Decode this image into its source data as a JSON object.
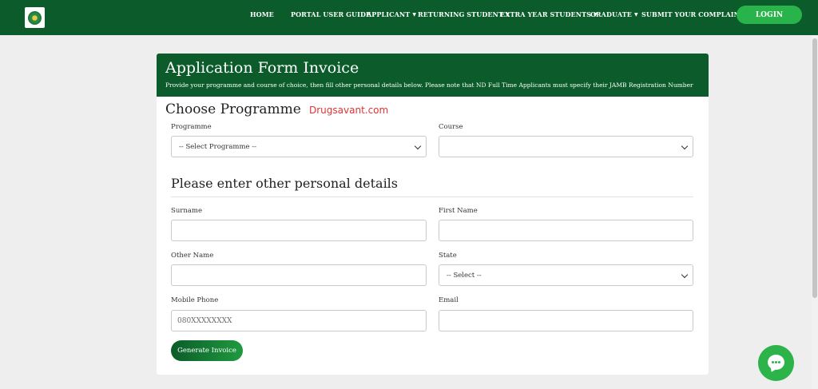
{
  "nav": {
    "home": "HOME",
    "portal_user_guide": "PORTAL USER GUIDE",
    "applicant": "APPLICANT",
    "returning_student": "RETURNING STUDENT",
    "extra_year_students": "EXTRA YEAR STUDENTS",
    "graduate": "GRADUATE",
    "submit_complaint": "SUBMIT YOUR COMPLAINT",
    "login": "LOGIN"
  },
  "card": {
    "title": "Application Form Invoice",
    "subtitle": "Provide your programme and course of choice, then fill other personal details below. Please note that ND Full Time Applicants must specify their JAMB Registration Number"
  },
  "choose_programme": {
    "heading": "Choose Programme",
    "watermark": "Drugsavant.com",
    "programme_label": "Programme",
    "programme_selected": "-- Select Programme --",
    "course_label": "Course",
    "course_selected": ""
  },
  "personal": {
    "heading": "Please enter other personal details",
    "surname_label": "Surname",
    "first_name_label": "First Name",
    "other_name_label": "Other Name",
    "state_label": "State",
    "state_selected": "-- Select --",
    "mobile_label": "Mobile Phone",
    "mobile_placeholder": "080XXXXXXXX",
    "email_label": "Email"
  },
  "actions": {
    "generate_invoice": "Generate Invoice"
  },
  "colors": {
    "brand_green": "#0b5c2a",
    "accent_green": "#28b44a",
    "watermark_red": "#e03333"
  },
  "icons": [
    "institution-logo-icon",
    "caret-down-icon",
    "chat-icon"
  ]
}
